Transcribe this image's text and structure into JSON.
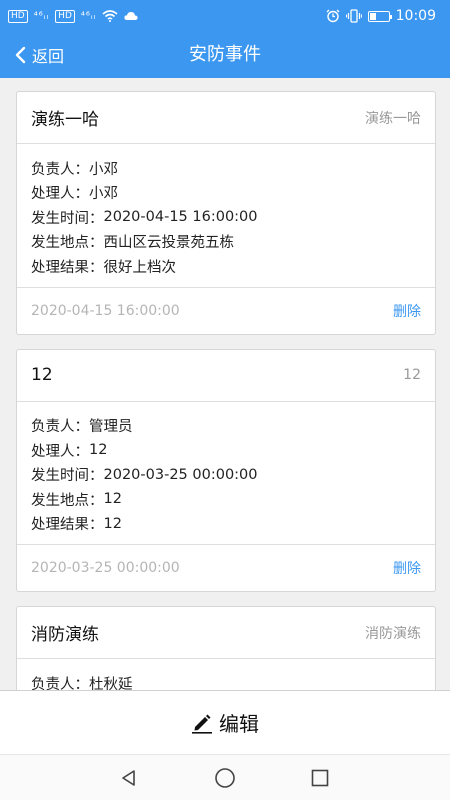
{
  "status_bar": {
    "left_chips": [
      "HD",
      "HD"
    ],
    "signal_a": "⁴⁶ᵢₗ",
    "signal_b": "⁴⁶ᵢₗ",
    "time": "10:09"
  },
  "nav": {
    "back_label": "返回",
    "title": "安防事件"
  },
  "cards": [
    {
      "title": "演练一哈",
      "tag": "演练一哈",
      "rows": [
        {
          "label": "负责人：",
          "value": "小邓"
        },
        {
          "label": "处理人：",
          "value": "小邓"
        },
        {
          "label": "发生时间：",
          "value": "2020-04-15 16:00:00"
        },
        {
          "label": "发生地点：",
          "value": "西山区云投景苑五栋"
        },
        {
          "label": "处理结果：",
          "value": "很好上档次"
        }
      ],
      "date": "2020-04-15 16:00:00",
      "delete_label": "删除"
    },
    {
      "title": "12",
      "tag": "12",
      "rows": [
        {
          "label": "负责人：",
          "value": "管理员"
        },
        {
          "label": "处理人：",
          "value": "12"
        },
        {
          "label": "发生时间：",
          "value": "2020-03-25 00:00:00"
        },
        {
          "label": "发生地点：",
          "value": "12"
        },
        {
          "label": "处理结果：",
          "value": "12"
        }
      ],
      "date": "2020-03-25 00:00:00",
      "delete_label": "删除"
    },
    {
      "title": "消防演练",
      "tag": "消防演练",
      "rows": [
        {
          "label": "负责人：",
          "value": "杜秋延"
        }
      ]
    }
  ],
  "edit_bar": {
    "label": "编辑",
    "icon": "pencil-icon"
  },
  "colors": {
    "primary": "#3b97f0",
    "date_text": "#b5b5b5",
    "tag_text": "#999999"
  }
}
